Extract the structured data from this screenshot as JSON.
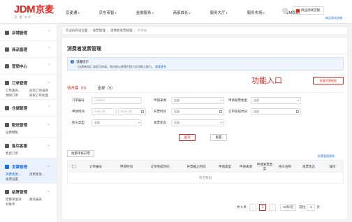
{
  "logo": {
    "brand": "JDM",
    "brand_cn": "京麦",
    "slogan": "用 · 懂 · 你 的"
  },
  "topnav": [
    {
      "label": "京麦通",
      "arrow": "▾"
    },
    {
      "label": "京东带智",
      "arrow": "▾"
    },
    {
      "label": "金融服务",
      "arrow": "▾"
    },
    {
      "label": "商家成长",
      "arrow": "▾"
    },
    {
      "label": "服务大厅",
      "arrow": "▾"
    },
    {
      "label": "服务市场",
      "arrow": "▾"
    },
    {
      "label": "C2M智造",
      "arrow": ""
    }
  ],
  "header": {
    "shop_label": "商品测试店铺",
    "sub_link": "商品测试店铺"
  },
  "sidebar": {
    "groups": [
      {
        "label": "店铺管理",
        "arrow": "›"
      },
      {
        "label": "商品管理",
        "arrow": "›"
      },
      {
        "label": "营销中心",
        "arrow": "›"
      },
      {
        "label": "订单管理",
        "arrow": "⌄"
      },
      {
        "label": "仓储管理",
        "arrow": "›"
      },
      {
        "label": "配送管理",
        "arrow": "⌄"
      },
      {
        "label": "售后客服",
        "arrow": "⌄"
      },
      {
        "label": "发票管理",
        "arrow": "⌄"
      },
      {
        "label": "结算管理",
        "arrow": "⌄"
      }
    ],
    "order_sub": [
      "订单查询...",
      "投诉订单查询",
      "预购订单",
      "商家订单处理"
    ],
    "delivery_sub": [
      "运费模板"
    ],
    "aftersale_sub": [
      "售后订单"
    ],
    "invoice_sub": [
      "消费者发...",
      "消费者发...",
      "发票设置"
    ],
    "settle_sub": [
      "结算单查询",
      "财务报表",
      "对账单"
    ]
  },
  "breadcrumb": [
    "京业的开设位置",
    "发票管理",
    "消费者发票管理",
    "待审核"
  ],
  "page": {
    "title": "消费者发票管理"
  },
  "notice": {
    "title": "温馨提示",
    "body": "【长期有效】商家可申请，到对接以便我们理力全项数大能力。",
    "link": "查看更多"
  },
  "feature": {
    "button": "批量开票授权",
    "annotation": "功能入口"
  },
  "tabs": [
    {
      "label": "待开票（0）",
      "active": true
    },
    {
      "label": "全部（5）",
      "active": false
    }
  ],
  "filters": {
    "order_no": {
      "label": "订单编号",
      "placeholder": "订单编号"
    },
    "source": {
      "label": "申请来源",
      "value": "全部"
    },
    "invoice_type": {
      "label": "申请发票类型",
      "value": "全部"
    },
    "apply_time": {
      "label": "申请时间",
      "start": "开始日期",
      "end": "结束日期"
    },
    "open_time": {
      "label": "开票时间",
      "value": "全部"
    },
    "order_done_time": {
      "label": "订单完成时间",
      "value": "全部"
    },
    "head_type": {
      "label": "抬头类型",
      "value": "全部"
    },
    "invoice_status": {
      "label": "发票状态",
      "value": "全部"
    }
  },
  "actions": {
    "search": "查询",
    "reset": "重置",
    "batch": "批量审核开票",
    "manage_link": "发票管理规则"
  },
  "table": {
    "columns": [
      "订单编号",
      "申请时间",
      "订单完成时间",
      "开票截止时间",
      "申请类型",
      "申请来源",
      "申请发票类型",
      "抬头名称",
      "发票状态",
      "操作"
    ],
    "empty": "暂无数据"
  },
  "pager": {
    "total": "共 0 条",
    "prev": "‹",
    "page": "1",
    "next": "›",
    "size": "10条/页",
    "goto": "前往",
    "goto_value": "1",
    "unit": "页"
  },
  "colors": {
    "brand": "#e2231a",
    "link": "#1a6fe0"
  }
}
